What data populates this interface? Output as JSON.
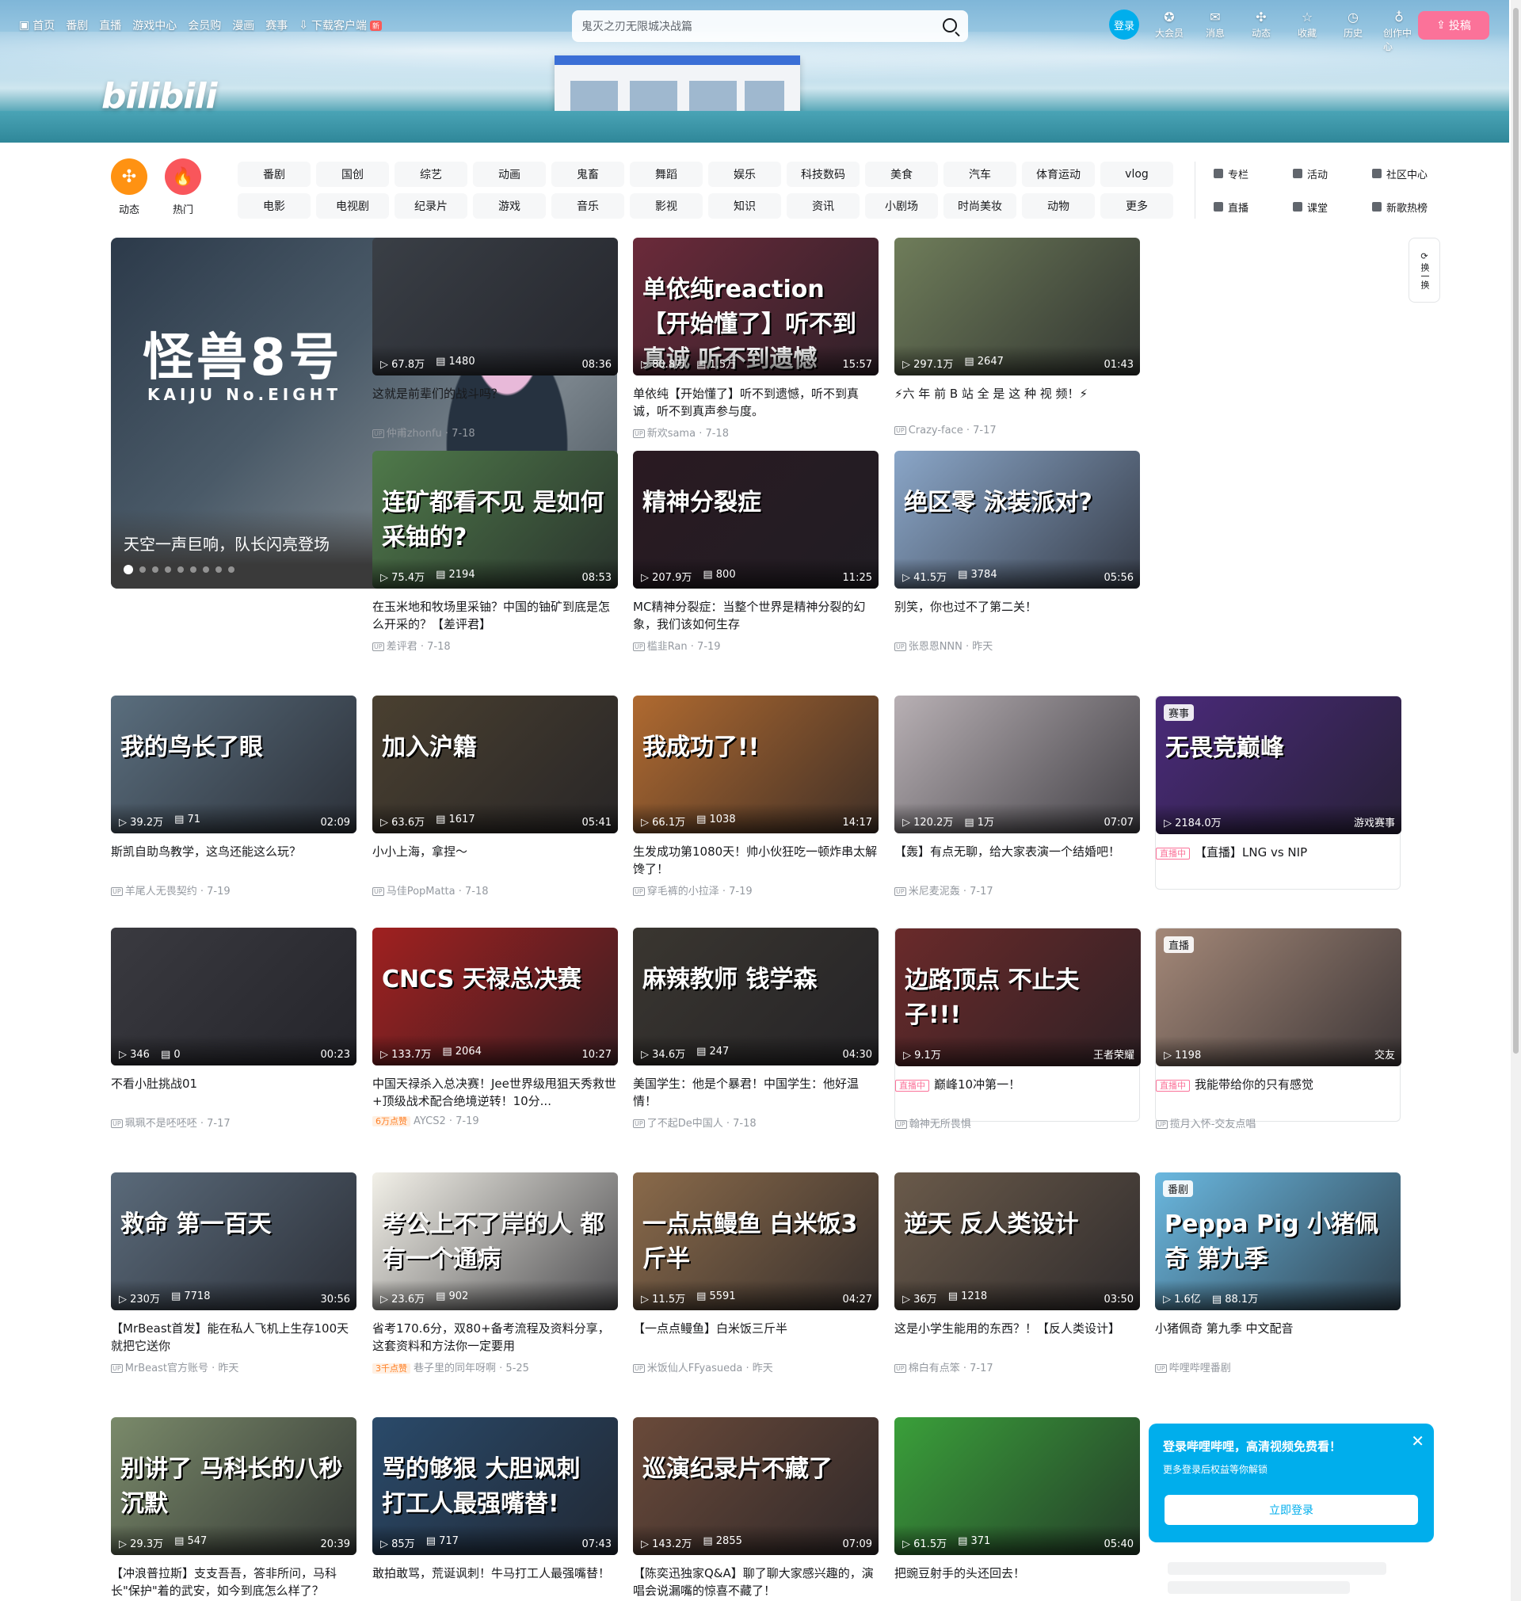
{
  "nav": {
    "left": [
      "首页",
      "番剧",
      "直播",
      "游戏中心",
      "会员购",
      "漫画",
      "赛事",
      "下载客户端"
    ],
    "new_badge": "新",
    "search_placeholder": "鬼灭之刃无限城决战篇",
    "login": "登录",
    "right": [
      {
        "icon": "vip-icon",
        "label": "大会员"
      },
      {
        "icon": "message-icon",
        "label": "消息"
      },
      {
        "icon": "dynamic-icon",
        "label": "动态"
      },
      {
        "icon": "star-icon",
        "label": "收藏"
      },
      {
        "icon": "clock-icon",
        "label": "历史"
      },
      {
        "icon": "bulb-icon",
        "label": "创作中心"
      }
    ],
    "upload": "投稿"
  },
  "channels": {
    "circles": [
      {
        "label": "动态",
        "color": "#ff9212",
        "icon": "✣"
      },
      {
        "label": "热门",
        "color": "#f9565b",
        "icon": "🔥"
      }
    ],
    "grid": [
      "番剧",
      "国创",
      "综艺",
      "动画",
      "鬼畜",
      "舞蹈",
      "娱乐",
      "科技数码",
      "美食",
      "汽车",
      "体育运动",
      "vlog",
      "电影",
      "电视剧",
      "纪录片",
      "游戏",
      "音乐",
      "影视",
      "知识",
      "资讯",
      "小剧场",
      "时尚美妆",
      "动物",
      "更多"
    ],
    "extra": [
      "专栏",
      "活动",
      "社区中心",
      "直播",
      "课堂",
      "新歌热榜"
    ]
  },
  "carousel": {
    "title_cn": "怪兽8号",
    "title_en": "KAIJU No.EIGHT",
    "caption": "天空一声巨响，队长闪亮登场",
    "dot_count": 9
  },
  "refresh": "换一换",
  "cards": [
    {
      "thumb_text": "",
      "views": "67.8万",
      "danmaku": "1480",
      "duration": "08:36",
      "title": "这就是前辈们的战斗吗？",
      "author": "仲甫zhonfu",
      "date": "7-18",
      "color": "#3a3f46"
    },
    {
      "thumb_text": "单依纯reaction 【开始懂了】听不到真诚 听不到遗憾",
      "views": "80.8万",
      "danmaku": "1.5万",
      "duration": "15:57",
      "title": "单依纯【开始懂了】听不到遗憾，听不到真诚，听不到真声参与度。",
      "author": "新欢sama",
      "date": "7-18",
      "color": "#6b2a3a"
    },
    {
      "thumb_text": "",
      "views": "297.1万",
      "danmaku": "2647",
      "duration": "01:43",
      "title": "⚡六 年 前 B 站 全 是 这 种 视 频！⚡",
      "author": "Crazy-face",
      "date": "7-17",
      "color": "#6f7d5a"
    },
    {
      "thumb_text": "连矿都看不见 是如何采铀的?",
      "views": "75.4万",
      "danmaku": "2194",
      "duration": "08:53",
      "title": "在玉米地和牧场里采铀？中国的铀矿到底是怎么开采的？【差评君】",
      "author": "差评君",
      "date": "7-18",
      "color": "#4f7a4a"
    },
    {
      "thumb_text": "精神分裂症",
      "views": "207.9万",
      "danmaku": "800",
      "duration": "11:25",
      "title": "MC精神分裂症：当整个世界是精神分裂的幻象，我们该如何生存",
      "author": "槛韭Ran",
      "date": "7-19",
      "color": "#2a1a22"
    },
    {
      "thumb_text": "绝区零 泳装派对?",
      "views": "41.5万",
      "danmaku": "3784",
      "duration": "05:56",
      "title": "别笑，你也过不了第二关！",
      "author": "张恩恩NNN",
      "date": "昨天",
      "color": "#8aa6c8"
    },
    {
      "thumb_text": "我的鸟长了眼",
      "views": "39.2万",
      "danmaku": "71",
      "duration": "02:09",
      "title": "斯凯自助鸟教学，这鸟还能这么玩？",
      "author": "羊尾人无畏契约",
      "date": "7-19",
      "color": "#5a6e7e"
    },
    {
      "thumb_text": "加入沪籍",
      "views": "63.6万",
      "danmaku": "1617",
      "duration": "05:41",
      "title": "小小上海，拿捏～",
      "author": "马佳PopMatta",
      "date": "7-18",
      "color": "#4a4030"
    },
    {
      "thumb_text": "我成功了!!",
      "views": "66.1万",
      "danmaku": "1038",
      "duration": "14:17",
      "title": "生发成功第1080天！帅小伙狂吃一顿炸串太解馋了！",
      "author": "穿毛裤的小拉泽",
      "date": "7-19",
      "color": "#b06a30"
    },
    {
      "thumb_text": "",
      "views": "120.2万",
      "danmaku": "1万",
      "duration": "07:07",
      "title": "【轰】有点无聊，给大家表演一个结婚吧！",
      "author": "米尼麦泥轰",
      "date": "7-17",
      "color": "#b8b0b4"
    },
    {
      "thumb_text": "无畏竞巅峰",
      "views": "2184.0万",
      "danmaku": "",
      "duration": "游戏赛事",
      "title": "【直播】LNG vs NIP",
      "author": "",
      "date": "",
      "badge": "赛事",
      "live": "直播中",
      "color": "#4a2a7a"
    },
    {
      "thumb_text": "",
      "views": "346",
      "danmaku": "0",
      "duration": "00:23",
      "title": "不看小肚挑战01",
      "author": "珮珮不是呸呸呸",
      "date": "7-17",
      "color": "#3a3a40"
    },
    {
      "thumb_text": "CNCS 天禄总决赛",
      "views": "133.7万",
      "danmaku": "2064",
      "duration": "10:27",
      "title": "中国天禄杀入总决赛！Jee世界级甩狙天秀救世+顶级战术配合绝境逆转！10分...",
      "author": "AYCS2",
      "date": "7-19",
      "hot": "6万点赞",
      "color": "#a02020"
    },
    {
      "thumb_text": "麻辣教师 钱学森",
      "views": "34.6万",
      "danmaku": "247",
      "duration": "04:30",
      "title": "美国学生：他是个暴君！中国学生：他好温情！",
      "author": "了不起De中国人",
      "date": "7-18",
      "color": "#3a3630"
    },
    {
      "thumb_text": "边路顶点 不止夫子!!!",
      "views": "9.1万",
      "danmaku": "",
      "duration": "王者荣耀",
      "title": "巅峰10冲第一！",
      "author": "翰神无所畏惧",
      "date": "",
      "live": "直播中",
      "color": "#6a2a2a"
    },
    {
      "thumb_text": "",
      "views": "1198",
      "danmaku": "",
      "duration": "交友",
      "title": "我能带给你的只有感觉",
      "author": "揽月入怀-交友点唱",
      "date": "",
      "badge": "直播",
      "live": "直播中",
      "color": "#a48878"
    },
    {
      "thumb_text": "救命 第一百天",
      "views": "230万",
      "danmaku": "7718",
      "duration": "30:56",
      "title": "【MrBeast首发】能在私人飞机上生存100天就把它送你",
      "author": "MrBeast官方账号",
      "date": "昨天",
      "color": "#5a6a7a"
    },
    {
      "thumb_text": "考公上不了岸的人 都有一个通病",
      "views": "23.6万",
      "danmaku": "902",
      "duration": "",
      "title": "省考170.6分，双80+备考流程及资料分享，这套资料和方法你一定要用",
      "author": "巷子里的同年呀啊",
      "date": "5-25",
      "hot": "3千点赞",
      "color": "#f2f0e8"
    },
    {
      "thumb_text": "一点点鳗鱼 白米饭3斤半",
      "views": "11.5万",
      "danmaku": "5591",
      "duration": "04:27",
      "title": "【一点点鳗鱼】白米饭三斤半",
      "author": "米饭仙人FFyasueda",
      "date": "昨天",
      "color": "#8a6a4a"
    },
    {
      "thumb_text": "逆天 反人类设计",
      "views": "36万",
      "danmaku": "1218",
      "duration": "03:50",
      "title": "这是小学生能用的东西？！【反人类设计】",
      "author": "棉白有点笨",
      "date": "7-17",
      "color": "#6a5a4a"
    },
    {
      "thumb_text": "Peppa Pig 小猪佩奇 第九季",
      "views": "1.6亿",
      "danmaku": "88.1万",
      "duration": "",
      "title": "小猪佩奇 第九季 中文配音",
      "author": "哔哩哔哩番剧",
      "date": "",
      "badge": "番剧",
      "color": "#6ab8e0"
    },
    {
      "thumb_text": "别讲了 马科长的八秒沉默",
      "views": "29.3万",
      "danmaku": "547",
      "duration": "20:39",
      "title": "【冲浪普拉斯】支支吾吾，答非所问，马科长\"保护\"着的武安，如今到底怎么样了？",
      "author": "",
      "date": "",
      "color": "#7a8a6a"
    },
    {
      "thumb_text": "骂的够狠 大胆讽刺 打工人最强嘴替!",
      "views": "85万",
      "danmaku": "717",
      "duration": "07:43",
      "title": "敢拍敢骂，荒诞讽刺！牛马打工人最强嘴替！",
      "author": "",
      "date": "",
      "color": "#2a4a6a"
    },
    {
      "thumb_text": "巡演纪录片不藏了",
      "views": "143.2万",
      "danmaku": "2855",
      "duration": "07:09",
      "title": "【陈奕迅独家Q&A】聊了聊大家感兴趣的，演唱会说漏嘴的惊喜不藏了！",
      "author": "",
      "date": "",
      "color": "#6a4a3a"
    },
    {
      "thumb_text": "",
      "views": "61.5万",
      "danmaku": "371",
      "duration": "05:40",
      "title": "把豌豆射手的头还回去！",
      "author": "",
      "date": "",
      "color": "#3aa03a"
    }
  ],
  "popup": {
    "heading": "登录哔哩哔哩，高清视频免费看！",
    "sub": "更多登录后权益等你解锁",
    "button": "立即登录"
  }
}
